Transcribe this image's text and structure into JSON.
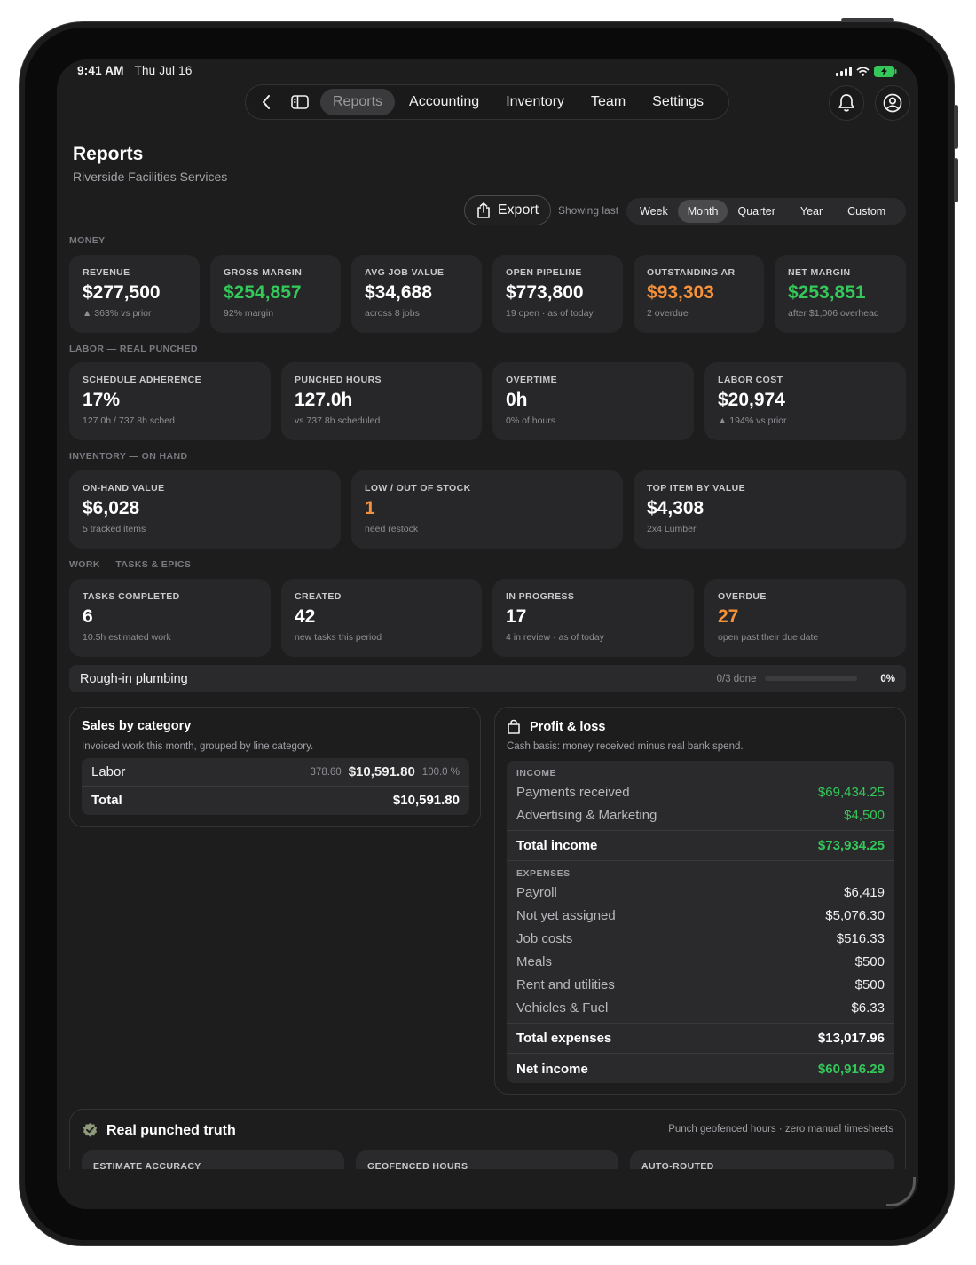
{
  "status": {
    "time": "9:41 AM",
    "date": "Thu Jul 16"
  },
  "nav": {
    "tabs": [
      {
        "label": "Reports"
      },
      {
        "label": "Accounting"
      },
      {
        "label": "Inventory"
      },
      {
        "label": "Team"
      },
      {
        "label": "Settings"
      }
    ]
  },
  "page": {
    "title": "Reports",
    "subtitle": "Riverside Facilities Services"
  },
  "toolbar": {
    "export_label": "Export",
    "showing_label": "Showing last",
    "periods": [
      "Week",
      "Month",
      "Quarter",
      "Year",
      "Custom"
    ],
    "selected_period": "Month"
  },
  "sections": {
    "money": "MONEY",
    "labor": "LABOR — REAL PUNCHED",
    "inventory": "INVENTORY — ON HAND",
    "work": "WORK — TASKS & EPICS"
  },
  "money": [
    {
      "label": "REVENUE",
      "value": "$277,500",
      "sub": "▲ 363% vs prior"
    },
    {
      "label": "GROSS MARGIN",
      "value": "$254,857",
      "sub": "92% margin"
    },
    {
      "label": "AVG JOB VALUE",
      "value": "$34,688",
      "sub": "across 8 jobs"
    },
    {
      "label": "OPEN PIPELINE",
      "value": "$773,800",
      "sub": "19 open · as of today"
    },
    {
      "label": "OUTSTANDING AR",
      "value": "$93,303",
      "sub": "2 overdue"
    },
    {
      "label": "NET MARGIN",
      "value": "$253,851",
      "sub": "after $1,006 overhead"
    }
  ],
  "labor": [
    {
      "label": "SCHEDULE ADHERENCE",
      "value": "17%",
      "sub": "127.0h / 737.8h sched"
    },
    {
      "label": "PUNCHED HOURS",
      "value": "127.0h",
      "sub": "vs 737.8h scheduled"
    },
    {
      "label": "OVERTIME",
      "value": "0h",
      "sub": "0% of hours"
    },
    {
      "label": "LABOR COST",
      "value": "$20,974",
      "sub": "▲ 194% vs prior"
    }
  ],
  "inventory": [
    {
      "label": "ON-HAND VALUE",
      "value": "$6,028",
      "sub": "5 tracked items"
    },
    {
      "label": "LOW / OUT OF STOCK",
      "value": "1",
      "sub": "need restock"
    },
    {
      "label": "TOP ITEM BY VALUE",
      "value": "$4,308",
      "sub": "2x4 Lumber"
    }
  ],
  "work": [
    {
      "label": "TASKS COMPLETED",
      "value": "6",
      "sub": "10.5h estimated work"
    },
    {
      "label": "CREATED",
      "value": "42",
      "sub": "new tasks this period"
    },
    {
      "label": "IN PROGRESS",
      "value": "17",
      "sub": "4 in review · as of today"
    },
    {
      "label": "OVERDUE",
      "value": "27",
      "sub": "open past their due date"
    }
  ],
  "epic": {
    "name": "Rough-in plumbing",
    "done": "0/3 done",
    "pct": "0%",
    "progress": 0
  },
  "sales": {
    "title": "Sales by category",
    "desc": "Invoiced work this month, grouped by line category.",
    "rows": [
      {
        "name": "Labor",
        "qty": "378.60",
        "amount": "$10,591.80",
        "share": "100.0 %"
      }
    ],
    "total_label": "Total",
    "total_value": "$10,591.80"
  },
  "pnl": {
    "title": "Profit & loss",
    "desc": "Cash basis: money received minus real bank spend.",
    "income_header": "INCOME",
    "income": [
      {
        "label": "Payments received",
        "value": "$69,434.25"
      },
      {
        "label": "Advertising & Marketing",
        "value": "$4,500"
      }
    ],
    "total_income_label": "Total income",
    "total_income_value": "$73,934.25",
    "expenses_header": "EXPENSES",
    "expenses": [
      {
        "label": "Payroll",
        "value": "$6,419"
      },
      {
        "label": "Not yet assigned",
        "value": "$5,076.30"
      },
      {
        "label": "Job costs",
        "value": "$516.33"
      },
      {
        "label": "Meals",
        "value": "$500"
      },
      {
        "label": "Rent and utilities",
        "value": "$500"
      },
      {
        "label": "Vehicles & Fuel",
        "value": "$6.33"
      }
    ],
    "total_expenses_label": "Total expenses",
    "total_expenses_value": "$13,017.96",
    "net_label": "Net income",
    "net_value": "$60,916.29"
  },
  "truth": {
    "title": "Real punched truth",
    "tagline": "Punch geofenced hours · zero manual timesheets",
    "cards": [
      "ESTIMATE ACCURACY",
      "GEOFENCED HOURS",
      "AUTO-ROUTED"
    ]
  },
  "colors": {
    "positive": "#34c759",
    "warning": "#f5913a",
    "background": "#1d1d1e",
    "card": "#272729"
  }
}
